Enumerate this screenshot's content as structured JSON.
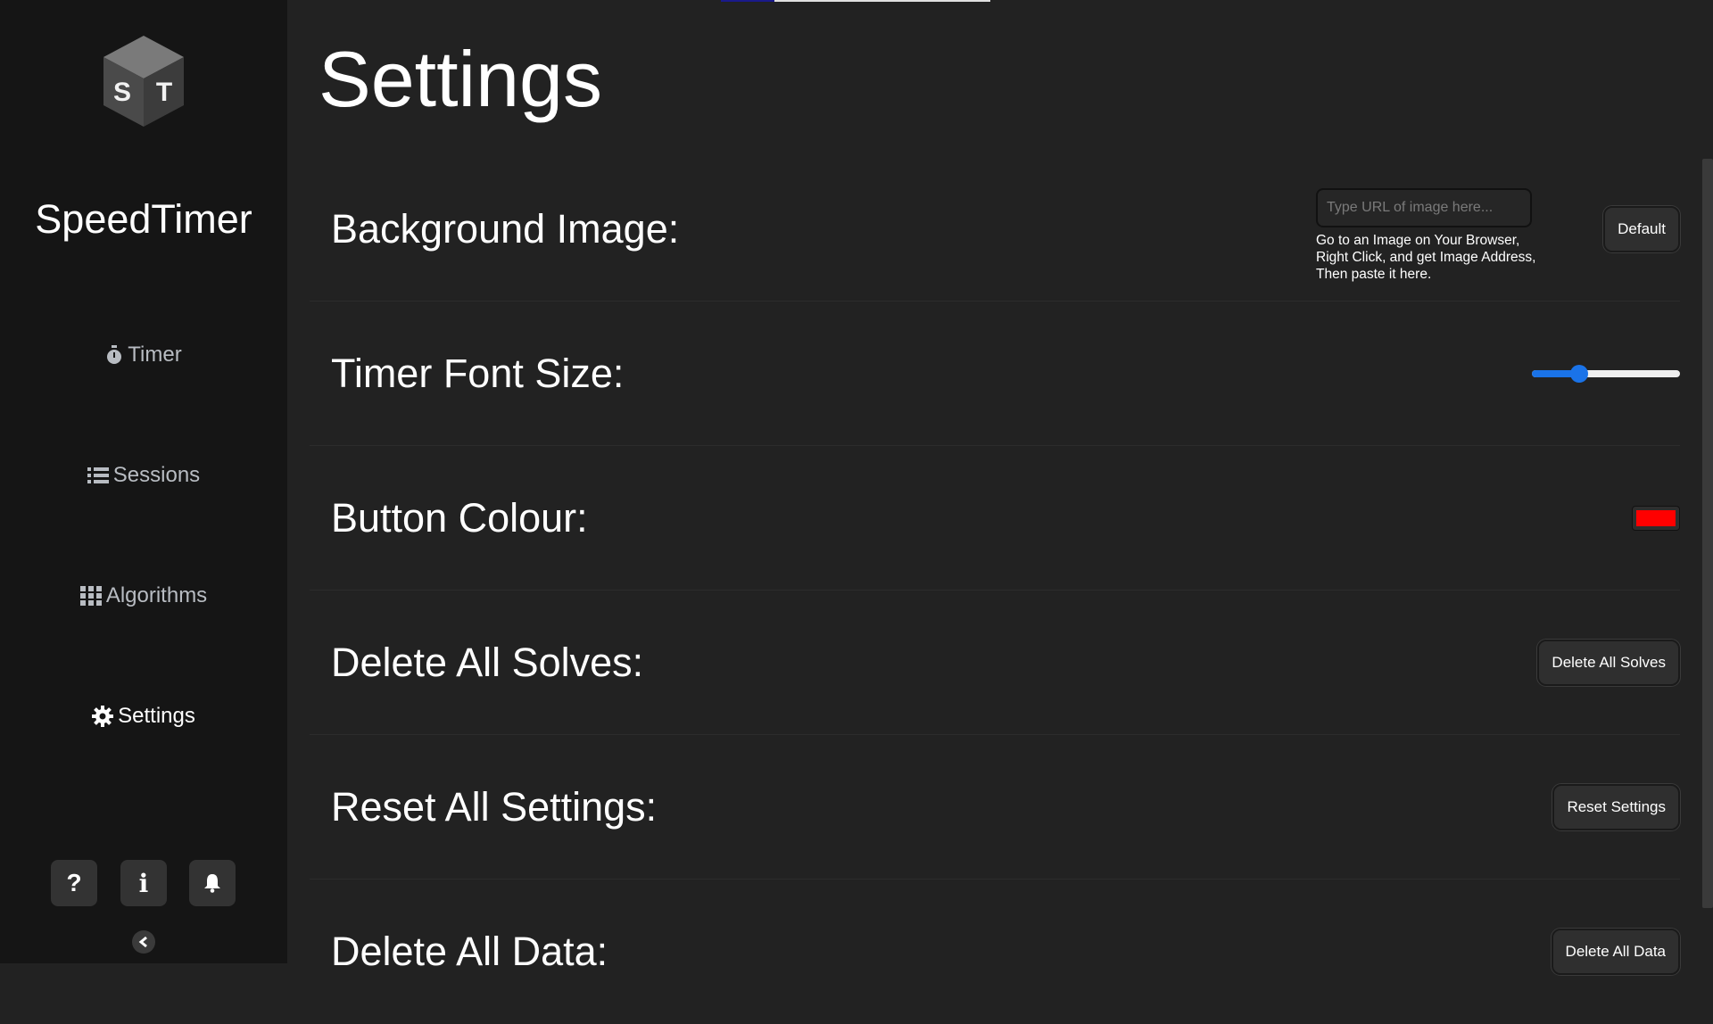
{
  "app": {
    "logo_letters": [
      "S",
      "T"
    ],
    "brand": "SpeedTimer"
  },
  "sidebar": {
    "items": [
      {
        "label": "Timer",
        "icon": "stopwatch-icon",
        "active": false
      },
      {
        "label": "Sessions",
        "icon": "list-icon",
        "active": false
      },
      {
        "label": "Algorithms",
        "icon": "grid-icon",
        "active": false
      },
      {
        "label": "Settings",
        "icon": "gear-icon",
        "active": true
      }
    ],
    "footer": {
      "help_glyph": "?",
      "info_glyph": "i",
      "icons": [
        "question-icon",
        "info-icon",
        "bell-icon",
        "chevron-left-icon"
      ]
    }
  },
  "page": {
    "title": "Settings"
  },
  "settings": {
    "background_image": {
      "label": "Background Image:",
      "input_value": "",
      "input_placeholder": "Type URL of image here...",
      "help_lines": [
        "Go to an Image on Your Browser,",
        "Right Click, and get Image Address,",
        "Then paste it here."
      ],
      "default_button": "Default"
    },
    "timer_font_size": {
      "label": "Timer Font Size:",
      "slider_fraction": 0.32
    },
    "button_colour": {
      "label": "Button Colour:",
      "value": "#ff0000"
    },
    "delete_all_solves": {
      "label": "Delete All Solves:",
      "button": "Delete All Solves"
    },
    "reset_all_settings": {
      "label": "Reset All Settings:",
      "button": "Reset Settings"
    },
    "delete_all_data": {
      "label": "Delete All Data:",
      "button": "Delete All Data"
    }
  },
  "colors": {
    "sidebar_bg": "#151515",
    "main_bg": "#222222",
    "accent": "#1a73e8",
    "button_colour": "#ff0000"
  }
}
